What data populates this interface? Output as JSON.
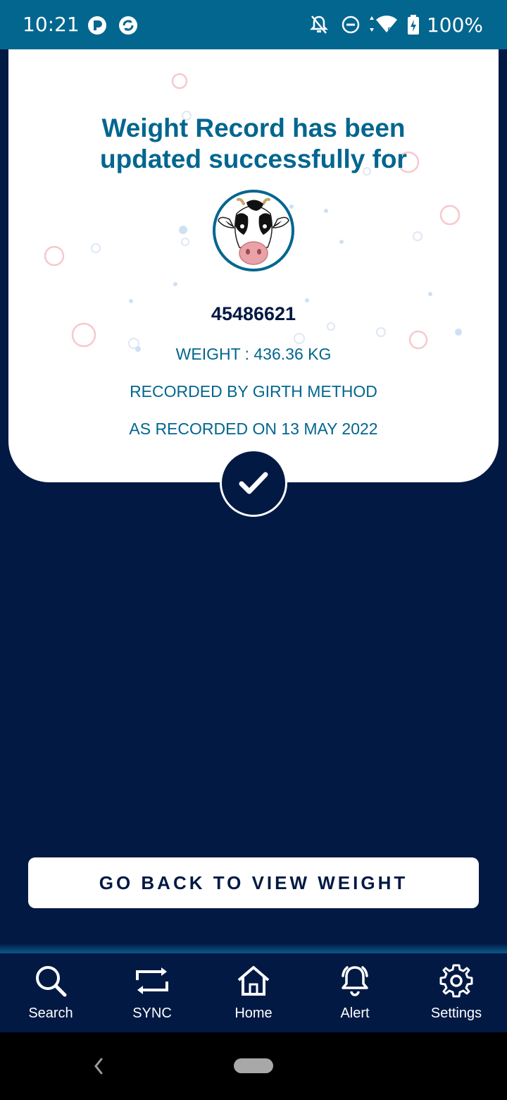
{
  "status_bar": {
    "time": "10:21",
    "battery": "100%",
    "icons": [
      "app-p-icon",
      "app-refresh-icon",
      "notifications-off-icon",
      "do-not-disturb-icon",
      "wifi-icon",
      "battery-charging-icon"
    ],
    "background_color": "#02668f"
  },
  "card": {
    "title": "Weight Record has been updated successfully for",
    "animal_avatar": "cow-avatar",
    "animal_id": "45486621",
    "weight_line": "WEIGHT : 436.36 KG",
    "method_line": "RECORDED BY GIRTH METHOD",
    "date_line": "AS RECORDED ON 13 MAY 2022",
    "success_icon": "checkmark-icon"
  },
  "actions": {
    "back_button_label": "GO BACK TO VIEW WEIGHT"
  },
  "bottom_nav": {
    "items": [
      {
        "label": "Search",
        "icon": "search-icon"
      },
      {
        "label": "SYNC",
        "icon": "sync-icon"
      },
      {
        "label": "Home",
        "icon": "home-icon"
      },
      {
        "label": "Alert",
        "icon": "alert-bell-icon"
      },
      {
        "label": "Settings",
        "icon": "gear-icon"
      }
    ]
  },
  "colors": {
    "primary_dark": "#021944",
    "accent_blue": "#02668f",
    "card_background": "#ffffff"
  }
}
